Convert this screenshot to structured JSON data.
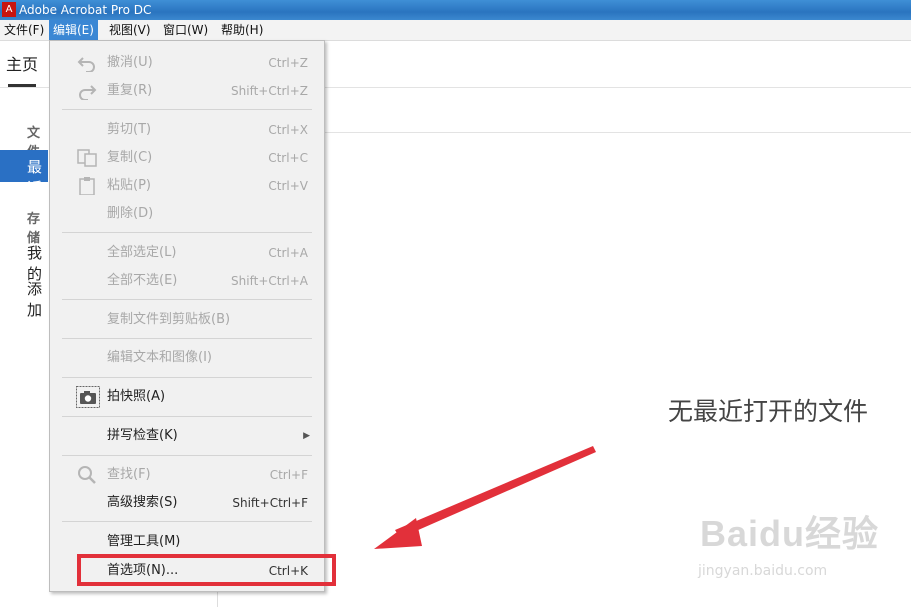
{
  "window": {
    "title": "Adobe Acrobat Pro DC",
    "logo_glyph": "A"
  },
  "menubar": [
    {
      "label": "文件(F)"
    },
    {
      "label": "编辑(E)"
    },
    {
      "label": "视图(V)"
    },
    {
      "label": "窗口(W)"
    },
    {
      "label": "帮助(H)"
    }
  ],
  "home_tab": "主页",
  "sidebar": {
    "section_files": "文件",
    "recent": "最近",
    "section_storage": "存储",
    "my_computer": "我的",
    "add": "添加"
  },
  "main": {
    "empty_message": "无最近打开的文件"
  },
  "edit_menu": {
    "undo": {
      "label": "撤消(U)",
      "shortcut": "Ctrl+Z",
      "icon": "undo-icon"
    },
    "redo": {
      "label": "重复(R)",
      "shortcut": "Shift+Ctrl+Z",
      "icon": "redo-icon"
    },
    "cut": {
      "label": "剪切(T)",
      "shortcut": "Ctrl+X"
    },
    "copy": {
      "label": "复制(C)",
      "shortcut": "Ctrl+C",
      "icon": "copy-icon"
    },
    "paste": {
      "label": "粘贴(P)",
      "shortcut": "Ctrl+V",
      "icon": "paste-icon"
    },
    "delete": {
      "label": "删除(D)"
    },
    "select_all": {
      "label": "全部选定(L)",
      "shortcut": "Ctrl+A"
    },
    "deselect_all": {
      "label": "全部不选(E)",
      "shortcut": "Shift+Ctrl+A"
    },
    "copy_file": {
      "label": "复制文件到剪贴板(B)"
    },
    "edit_text": {
      "label": "编辑文本和图像(I)"
    },
    "snapshot": {
      "label": "拍快照(A)",
      "icon": "camera-icon"
    },
    "spell_check": {
      "label": "拼写检查(K)"
    },
    "find": {
      "label": "查找(F)",
      "shortcut": "Ctrl+F",
      "icon": "search-icon"
    },
    "advanced_search": {
      "label": "高级搜索(S)",
      "shortcut": "Shift+Ctrl+F"
    },
    "manage_tools": {
      "label": "管理工具(M)"
    },
    "preferences": {
      "label": "首选项(N)...",
      "shortcut": "Ctrl+K"
    }
  },
  "colors": {
    "menu_active": "#3b87d4",
    "sidebar_selected": "#2a70c4",
    "annotation": "#e2303a"
  },
  "watermark": {
    "brand": "Baidu经验",
    "url": "jingyan.baidu.com"
  }
}
